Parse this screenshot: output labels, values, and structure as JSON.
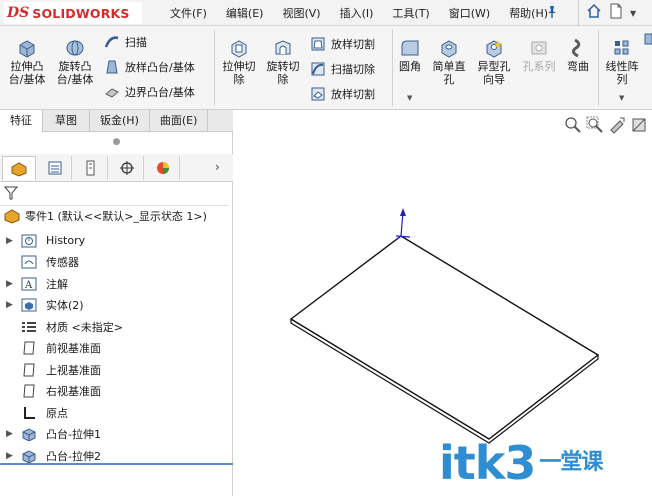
{
  "app": {
    "logo_ds": "DS",
    "logo_name": "SOLIDWORKS"
  },
  "menu": [
    "文件(F)",
    "编辑(E)",
    "视图(V)",
    "插入(I)",
    "工具(T)",
    "窗口(W)",
    "帮助(H)"
  ],
  "ribbon": {
    "extrude_boss": "拉伸凸\n台/基体",
    "revolve_boss": "旋转凸\n台/基体",
    "sweep": "扫描",
    "loft_boss": "放样凸台/基体",
    "boundary_boss": "边界凸台/基体",
    "extrude_cut": "拉伸切\n除",
    "revolve_cut": "旋转切\n除",
    "loft_cut": "放样切割",
    "sweep_cut": "扫描切除",
    "boundary_cut": "放样切割",
    "fillet": "圆角",
    "simple_hole": "简单直\n孔",
    "hole_wizard": "异型孔\n向导",
    "hole_series": "孔系列",
    "flex": "弯曲",
    "linear_pattern": "线性阵\n列"
  },
  "cm_tabs": [
    "特征",
    "草图",
    "钣金(H)",
    "曲面(E)"
  ],
  "feature_tree": {
    "root": "零件1 (默认<<默认>_显示状态 1>)",
    "nodes": [
      {
        "label": "History",
        "expandable": true
      },
      {
        "label": "传感器",
        "expandable": false
      },
      {
        "label": "注解",
        "expandable": true
      },
      {
        "label": "实体(2)",
        "expandable": true
      },
      {
        "label": "材质 <未指定>",
        "expandable": false
      },
      {
        "label": "前视基准面",
        "expandable": false
      },
      {
        "label": "上视基准面",
        "expandable": false
      },
      {
        "label": "右视基准面",
        "expandable": false
      },
      {
        "label": "原点",
        "expandable": false
      },
      {
        "label": "凸台-拉伸1",
        "expandable": true
      },
      {
        "label": "凸台-拉伸2",
        "expandable": true
      }
    ]
  },
  "watermark": {
    "text": "itk3",
    "cn": "一堂课"
  },
  "colors": {
    "brand": "#d62b2b",
    "accent": "#2f8ed1",
    "selection": "#5b8bd0"
  }
}
